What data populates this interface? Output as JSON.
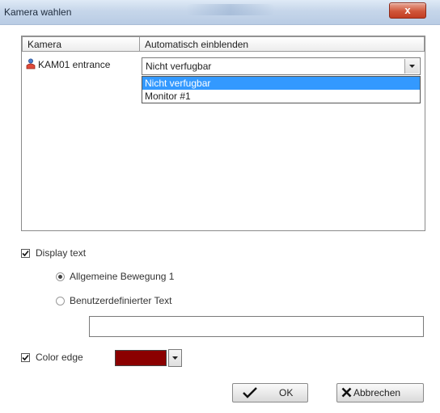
{
  "window": {
    "title": "Kamera wahlen",
    "close_label": "x"
  },
  "listview": {
    "columns": [
      "Kamera",
      "Automatisch einblenden"
    ],
    "row": {
      "camera_name": "KAM01 entrance",
      "camera_icon": "camera-person-icon",
      "combo_value": "Nicht verfugbar"
    },
    "dropdown_options": [
      "Nicht verfugbar",
      "Monitor #1"
    ],
    "selected_option": "Nicht verfugbar"
  },
  "display_text": {
    "label": "Display text",
    "checked": true,
    "options": [
      {
        "label": "Allgemeine Bewegung 1",
        "selected": true
      },
      {
        "label": "Benutzerdefinierter Text",
        "selected": false
      }
    ],
    "custom_text_value": ""
  },
  "color_edge": {
    "label": "Color edge",
    "checked": true,
    "color": "#8b0000"
  },
  "buttons": {
    "ok_label": "OK",
    "cancel_label": "Abbrechen"
  },
  "colors": {
    "selection": "#3399ff",
    "titlebar": "#c6d6ea",
    "close_button": "#d0563a"
  }
}
